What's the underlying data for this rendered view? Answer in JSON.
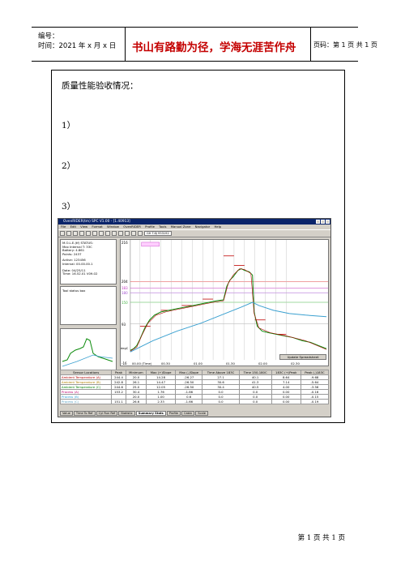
{
  "header": {
    "number_label": "编号：",
    "time_label": "时间：2021 年 x 月 x 日",
    "motto": "书山有路勤为径，学海无涯苦作舟",
    "page_info": "页码：第 1 页  共 1 页"
  },
  "content": {
    "title": "质量性能验收情况：",
    "items": [
      "1）",
      "2）",
      "3）"
    ]
  },
  "screenshot": {
    "window_title": "OvenRIDER(tm) SPC V1.00 - [1.40913]",
    "menu": [
      "File",
      "Edit",
      "View",
      "Format",
      "Window",
      "OvenRIDER",
      "Profile",
      "Tools",
      "Manual Zone",
      "Navigator",
      "Help"
    ],
    "toolbar_select": "GH T.8J 953192",
    "status_lines": [
      "M.O.L.E.(tf) STATUS:",
      "Max Internal T: 33C",
      "Battery: 4.861",
      "Points: 2437",
      "",
      "Active: 123456",
      "Interval: 00.00.00.1",
      "",
      "Date: 04/25/11",
      "Time: 16.52.01 V09.02"
    ],
    "tool_status": "Tool status box",
    "show_sensors": "Show Sensors",
    "update_button": "Update Spreadsheet",
    "y_ticks": [
      "216",
      "204",
      "183",
      "180",
      "150",
      "93",
      "degC",
      "-16"
    ],
    "x_ticks": [
      "00.00 (Time)",
      "00.30",
      "01.00",
      "01.30",
      "02.00",
      "02.30"
    ],
    "columns": [
      "Sensor Locations",
      "Peak",
      "Minimum",
      "Max (+)Slope",
      "Max (-)Slope",
      "Time Above 183C",
      "Time 150-180C",
      "183C (+)Peak",
      "Peak (-)183C"
    ],
    "rows": [
      [
        "Ambient Temperature (A)",
        "244.4",
        "20.0",
        "14.28",
        "-26.27",
        "27.1",
        "40.1",
        "8.64",
        "-9.68"
      ],
      [
        "Ambient Temperature (B)",
        "242.8",
        "26.1",
        "14.47",
        "-26.50",
        "30.6",
        "41.3",
        "7.14",
        "-5.64"
      ],
      [
        "Ambient Temperature (C)",
        "244.6",
        "25.0",
        "12.05",
        "-26.50",
        "30.4",
        "40.5",
        "4.00",
        "-3.56"
      ],
      [
        "Process (A)",
        "153.2",
        "30.4",
        "1.76",
        "-1.66",
        "0.0",
        "0.0",
        "0.00",
        "-0.16"
      ],
      [
        "Process (B)",
        "",
        "20.0",
        "1.00",
        "0.6",
        "0.0",
        "0.0",
        "0.00",
        "-0.15"
      ],
      [
        "Process (C)",
        "151.1",
        "26.6",
        "2.33",
        "-1.66",
        "0.0",
        "0.0",
        "0.00",
        "-0.19"
      ]
    ],
    "row_colors": [
      "#b00000",
      "#b08000",
      "#008000",
      "#c00070",
      "#2a9cd6",
      "#5aa0c0"
    ],
    "tabs": [
      "Value",
      "Time To Ref",
      "Cyl Run Ref",
      "Statistic",
      "Summary Stats",
      "Profile",
      "Cabin",
      "Scale"
    ],
    "active_tab": "Summary Stats"
  },
  "footer": "第 1 页  共 1 页"
}
